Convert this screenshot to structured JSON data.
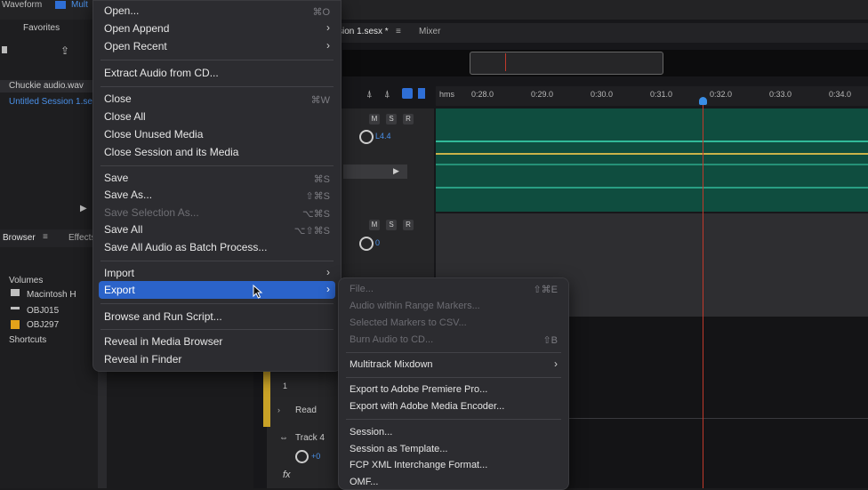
{
  "topbar": {
    "waveform_tab": "Waveform",
    "multitrack_tab": "Mult"
  },
  "files_panel": {
    "favorites_label": "Favorites",
    "files": [
      "Chuckie audio.wav",
      "Untitled Session 1.se"
    ]
  },
  "browser_panel": {
    "browser_tab": "Browser",
    "effects_tab": "Effects",
    "volumes_label": "Volumes",
    "volumes": [
      "Macintosh H",
      "OBJ015",
      "OBJ297"
    ],
    "shortcuts_label": "Shortcuts"
  },
  "editor": {
    "session_tab": "sion 1.sesx *",
    "mixer_tab": "Mixer",
    "ruler_unit": "hms",
    "ruler_ticks": [
      "0:28.0",
      "0:29.0",
      "0:30.0",
      "0:31.0",
      "0:32.0",
      "0:33.0",
      "0:34.0"
    ],
    "track1": {
      "btn_m": "M",
      "btn_s": "S",
      "btn_r": "R",
      "volume": "L4.4"
    },
    "track2": {
      "btn_m": "M",
      "btn_s": "S",
      "btn_r": "R",
      "volume": "0"
    },
    "track3": {
      "input": "1",
      "mode": "Read"
    },
    "track4": {
      "name": "Track 4",
      "volume": "+0",
      "fx": "fx"
    }
  },
  "file_menu": {
    "items": [
      {
        "label": "Open...",
        "shortcut": "⌘O"
      },
      {
        "label": "Open Append",
        "submenu": true
      },
      {
        "label": "Open Recent",
        "submenu": true
      },
      {
        "label": "Extract Audio from CD..."
      },
      {
        "label": "Close",
        "shortcut": "⌘W"
      },
      {
        "label": "Close All"
      },
      {
        "label": "Close Unused Media"
      },
      {
        "label": "Close Session and its Media"
      },
      {
        "label": "Save",
        "shortcut": "⌘S"
      },
      {
        "label": "Save As...",
        "shortcut": "⇧⌘S"
      },
      {
        "label": "Save Selection As...",
        "shortcut": "⌥⌘S",
        "disabled": true
      },
      {
        "label": "Save All",
        "shortcut": "⌥⇧⌘S"
      },
      {
        "label": "Save All Audio as Batch Process..."
      },
      {
        "label": "Import",
        "submenu": true
      },
      {
        "label": "Export",
        "submenu": true,
        "highlighted": true
      },
      {
        "label": "Browse and Run Script..."
      },
      {
        "label": "Reveal in Media Browser"
      },
      {
        "label": "Reveal in Finder"
      }
    ]
  },
  "export_submenu": {
    "items": [
      {
        "label": "File...",
        "shortcut": "⇧⌘E",
        "disabled": true
      },
      {
        "label": "Audio within Range Markers...",
        "disabled": true
      },
      {
        "label": "Selected Markers to CSV...",
        "disabled": true
      },
      {
        "label": "Burn Audio to CD...",
        "shortcut": "⇧B",
        "disabled": true
      },
      {
        "label": "Multitrack Mixdown",
        "submenu": true
      },
      {
        "label": "Export to Adobe Premiere Pro..."
      },
      {
        "label": "Export with Adobe Media Encoder..."
      },
      {
        "label": "Session..."
      },
      {
        "label": "Session as Template..."
      },
      {
        "label": "FCP XML Interchange Format..."
      },
      {
        "label": "OMF..."
      }
    ]
  },
  "colors": {
    "accent": "#2b63c9",
    "track_green": "#0f4d3f",
    "playhead": "#c0392b"
  }
}
